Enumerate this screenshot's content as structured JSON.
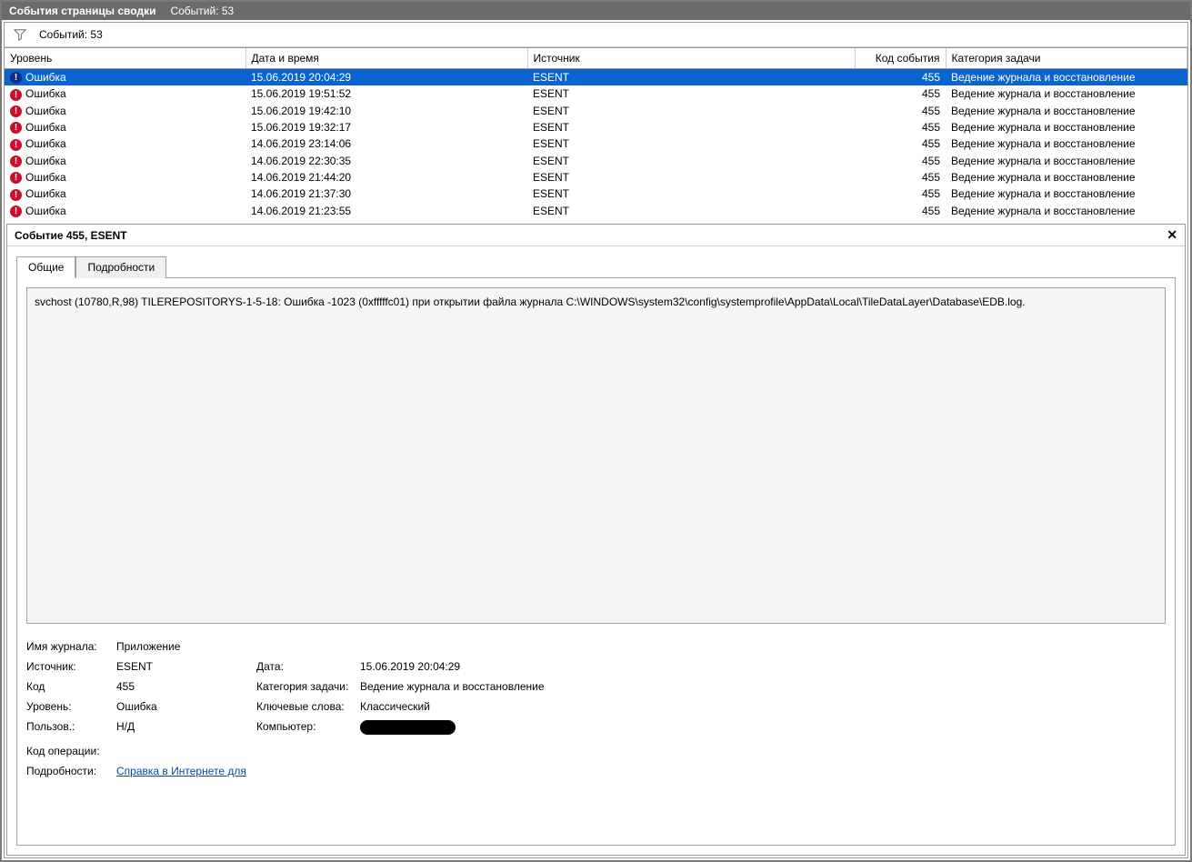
{
  "titlebar": {
    "title": "События страницы сводки",
    "count_label": "Событий: 53"
  },
  "filterbar": {
    "count_label": "Событий: 53"
  },
  "columns": {
    "level": "Уровень",
    "datetime": "Дата и время",
    "source": "Источник",
    "event_id": "Код события",
    "task": "Категория задачи"
  },
  "rows": [
    {
      "level": "Ошибка",
      "datetime": "15.06.2019 20:04:29",
      "source": "ESENT",
      "event_id": "455",
      "task": "Ведение журнала и восстановление",
      "selected": true
    },
    {
      "level": "Ошибка",
      "datetime": "15.06.2019 19:51:52",
      "source": "ESENT",
      "event_id": "455",
      "task": "Ведение журнала и восстановление"
    },
    {
      "level": "Ошибка",
      "datetime": "15.06.2019 19:42:10",
      "source": "ESENT",
      "event_id": "455",
      "task": "Ведение журнала и восстановление"
    },
    {
      "level": "Ошибка",
      "datetime": "15.06.2019 19:32:17",
      "source": "ESENT",
      "event_id": "455",
      "task": "Ведение журнала и восстановление"
    },
    {
      "level": "Ошибка",
      "datetime": "14.06.2019 23:14:06",
      "source": "ESENT",
      "event_id": "455",
      "task": "Ведение журнала и восстановление"
    },
    {
      "level": "Ошибка",
      "datetime": "14.06.2019 22:30:35",
      "source": "ESENT",
      "event_id": "455",
      "task": "Ведение журнала и восстановление"
    },
    {
      "level": "Ошибка",
      "datetime": "14.06.2019 21:44:20",
      "source": "ESENT",
      "event_id": "455",
      "task": "Ведение журнала и восстановление"
    },
    {
      "level": "Ошибка",
      "datetime": "14.06.2019 21:37:30",
      "source": "ESENT",
      "event_id": "455",
      "task": "Ведение журнала и восстановление"
    },
    {
      "level": "Ошибка",
      "datetime": "14.06.2019 21:23:55",
      "source": "ESENT",
      "event_id": "455",
      "task": "Ведение журнала и восстановление"
    }
  ],
  "detail": {
    "header": "Событие 455, ESENT",
    "tabs": {
      "general": "Общие",
      "details": "Подробности"
    },
    "description": "svchost (10780,R,98) TILEREPOSITORYS-1-5-18: Ошибка -1023 (0xfffffc01) при открытии файла журнала C:\\WINDOWS\\system32\\config\\systemprofile\\AppData\\Local\\TileDataLayer\\Database\\EDB.log.",
    "meta": {
      "log_name_label": "Имя журнала:",
      "log_name_value": "Приложение",
      "source_label": "Источник:",
      "source_value": "ESENT",
      "date_label": "Дата:",
      "date_value": "15.06.2019 20:04:29",
      "id_label": "Код",
      "id_value": "455",
      "task_label": "Категория задачи:",
      "task_value": "Ведение журнала и восстановление",
      "level_label": "Уровень:",
      "level_value": "Ошибка",
      "keywords_label": "Ключевые слова:",
      "keywords_value": "Классический",
      "user_label": "Пользов.:",
      "user_value": "Н/Д",
      "computer_label": "Компьютер:",
      "opcode_label": "Код операции:",
      "opcode_value": "",
      "moreinfo_label": "Подробности:",
      "moreinfo_link": "Справка в Интернете для "
    }
  }
}
